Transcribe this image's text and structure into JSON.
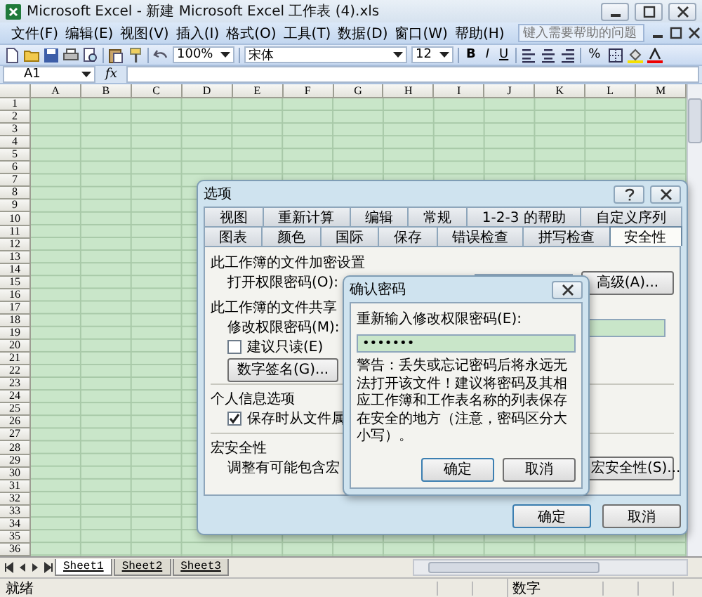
{
  "window": {
    "title": "Microsoft Excel - 新建 Microsoft Excel 工作表 (4).xls"
  },
  "menu": [
    {
      "label": "文件(F)"
    },
    {
      "label": "编辑(E)"
    },
    {
      "label": "视图(V)"
    },
    {
      "label": "插入(I)"
    },
    {
      "label": "格式(O)"
    },
    {
      "label": "工具(T)"
    },
    {
      "label": "数据(D)"
    },
    {
      "label": "窗口(W)"
    },
    {
      "label": "帮助(H)"
    }
  ],
  "help_search": {
    "placeholder": "键入需要帮助的问题"
  },
  "toolbar": {
    "zoom": "100%",
    "font": "宋体",
    "font_size": "12",
    "format_buttons": [
      {
        "kind": "bold",
        "label": "B"
      },
      {
        "kind": "italic",
        "label": "I"
      },
      {
        "kind": "underline",
        "label": "U"
      }
    ],
    "percent": "%"
  },
  "formula_bar": {
    "name_box": "A1",
    "function_label": "fx"
  },
  "sheet": {
    "columns": [
      "A",
      "B",
      "C",
      "D",
      "E",
      "F",
      "G",
      "H",
      "I",
      "J",
      "K",
      "L",
      "M"
    ],
    "rows": [
      "1",
      "2",
      "3",
      "4",
      "5",
      "6",
      "7",
      "8",
      "9",
      "10",
      "11",
      "12",
      "13",
      "14",
      "15",
      "16",
      "17",
      "18",
      "19",
      "20",
      "21",
      "22",
      "23",
      "24",
      "25",
      "26",
      "27",
      "28",
      "29",
      "30",
      "31",
      "32",
      "33",
      "34",
      "35",
      "36"
    ]
  },
  "sheet_tabs": [
    {
      "label": "Sheet1",
      "selected": true
    },
    {
      "label": "Sheet2",
      "selected": false
    },
    {
      "label": "Sheet3",
      "selected": false
    }
  ],
  "status_bar": {
    "state": "就绪",
    "mode": "数字"
  },
  "options_dialog": {
    "title": "选项",
    "tab_rows": [
      {
        "tabs": [
          {
            "label": "视图",
            "selected": false
          },
          {
            "label": "重新计算",
            "selected": false
          },
          {
            "label": "编辑",
            "selected": false
          },
          {
            "label": "常规",
            "selected": false
          },
          {
            "label": "1-2-3 的帮助",
            "selected": false
          },
          {
            "label": "自定义序列",
            "selected": false
          }
        ]
      },
      {
        "tabs": [
          {
            "label": "图表",
            "selected": false
          },
          {
            "label": "颜色",
            "selected": false
          },
          {
            "label": "国际",
            "selected": false
          },
          {
            "label": "保存",
            "selected": false
          },
          {
            "label": "错误检查",
            "selected": false
          },
          {
            "label": "拼写检查",
            "selected": false
          },
          {
            "label": "安全性",
            "selected": true
          }
        ]
      }
    ],
    "encryption_heading": "此工作簿的文件加密设置",
    "open_password_label": "打开权限密码(O):",
    "advanced_button": "高级(A)...",
    "sharing_heading": "此工作簿的文件共享",
    "modify_password_label": "修改权限密码(M):",
    "read_only": {
      "label": "建议只读(E)",
      "checked": false
    },
    "signature_button": "数字签名(G)...",
    "privacy_heading": "个人信息选项",
    "remove_info": {
      "label": "保存时从文件属",
      "checked": true
    },
    "macro_heading": "宏安全性",
    "macro_text": "调整有可能包含宏",
    "macro_button": "宏安全性(S)...",
    "buttons": [
      "确定",
      "取消"
    ]
  },
  "confirm_dialog": {
    "title": "确认密码",
    "prompt": "重新输入修改权限密码(E):",
    "value": "•••••••",
    "warning": "警告：丢失或忘记密码后将永远无法打开该文件！建议将密码及其相应工作簿和工作表名称的列表保存在安全的地方（注意，密码区分大小写）。",
    "buttons": [
      "确定",
      "取消"
    ]
  }
}
